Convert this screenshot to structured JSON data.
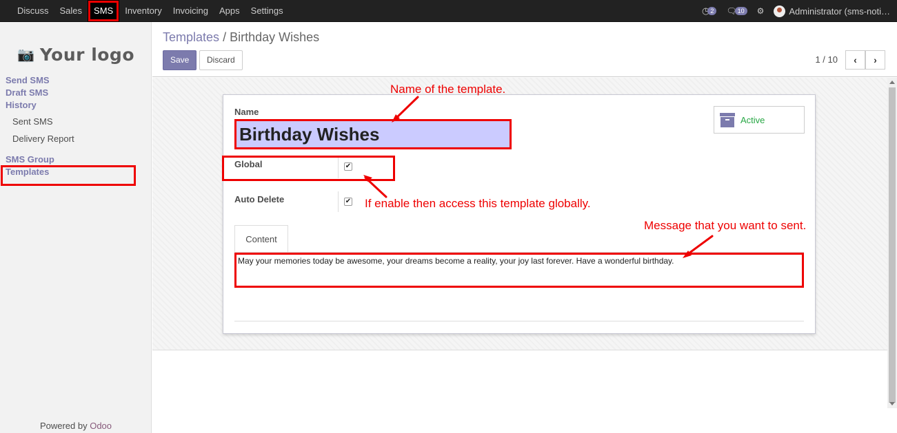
{
  "topbar": {
    "menu": [
      "Discuss",
      "Sales",
      "SMS",
      "Inventory",
      "Invoicing",
      "Apps",
      "Settings"
    ],
    "active_menu": "SMS",
    "activity_badge": "2",
    "message_badge": "10",
    "user": "Administrator (sms-noti…"
  },
  "sidebar": {
    "logo_text": "Your logo",
    "items": [
      {
        "label": "Send SMS",
        "type": "head"
      },
      {
        "label": "Draft SMS",
        "type": "head"
      },
      {
        "label": "History",
        "type": "head"
      },
      {
        "label": "Sent SMS",
        "type": "sub"
      },
      {
        "label": "Delivery Report",
        "type": "sub"
      },
      {
        "label": "SMS Group",
        "type": "head"
      },
      {
        "label": "Templates",
        "type": "head"
      }
    ],
    "powered_prefix": "Powered by ",
    "powered_brand": "Odoo"
  },
  "control_panel": {
    "breadcrumb_parent": "Templates",
    "breadcrumb_sep": "/",
    "breadcrumb_current": "Birthday Wishes",
    "save_label": "Save",
    "discard_label": "Discard",
    "pager": "1 / 10"
  },
  "form": {
    "name_label": "Name",
    "name_value": "Birthday Wishes",
    "active_label": "Active",
    "global_label": "Global",
    "global_checked": true,
    "auto_delete_label": "Auto Delete",
    "auto_delete_checked": true,
    "tab_label": "Content",
    "content_value": "May your memories today be awesome, your dreams become a reality, your joy last forever. Have a wonderful birthday."
  },
  "annotations": {
    "name": "Name of the template.",
    "global": "If enable then access this template globally.",
    "message": "Message that you want to sent."
  },
  "colors": {
    "brand": "#7c7bad",
    "highlight": "#ee0000",
    "active_green": "#28a745",
    "name_field_bg": "#cbcbff"
  },
  "icons": [
    "camera-icon",
    "archive-icon",
    "clock-icon",
    "chat-icon",
    "bug-icon",
    "chevron-left-icon",
    "chevron-right-icon"
  ]
}
